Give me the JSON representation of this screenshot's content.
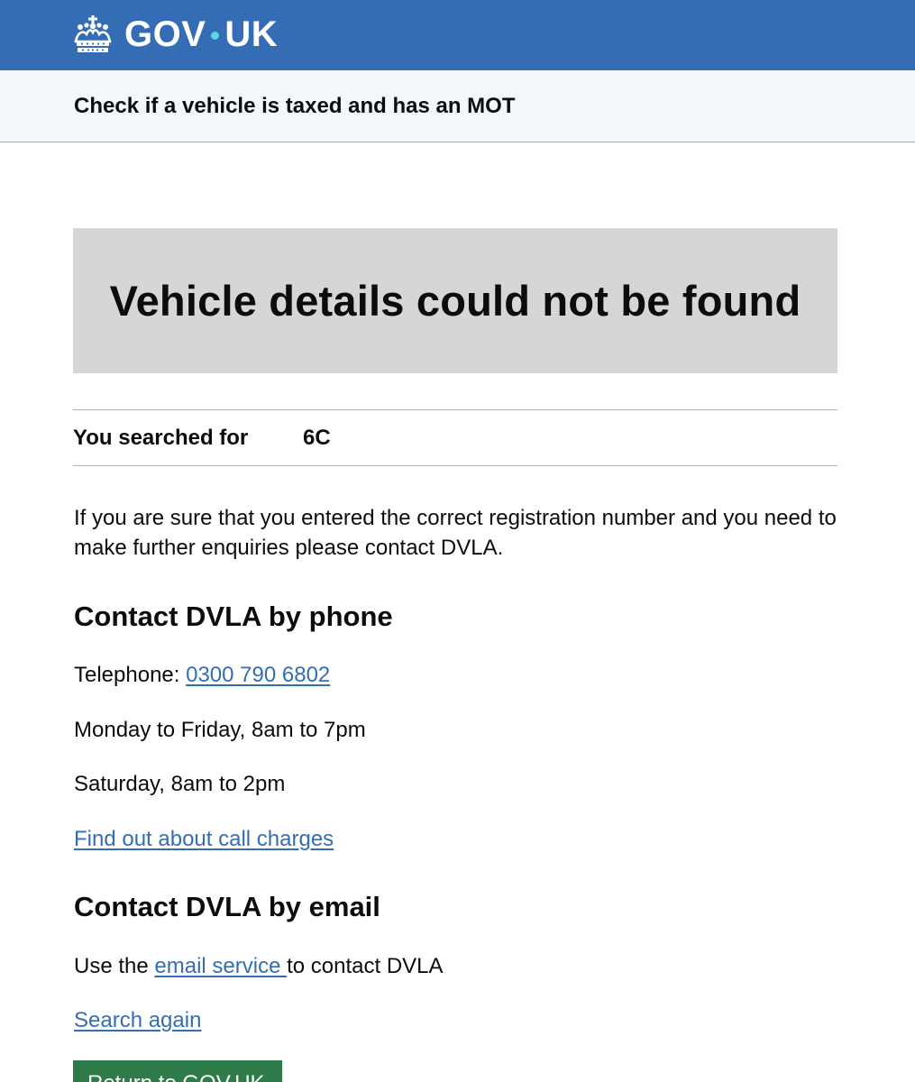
{
  "colors": {
    "brand": "#356db4",
    "dot": "#5bd7e6",
    "link": "#356db4",
    "panel": "#d6d6d6",
    "button": "#2e7a48"
  },
  "header": {
    "logo_left": "GOV",
    "logo_right": "UK",
    "crown_icon": "crown-icon"
  },
  "service": {
    "name": "Check if a vehicle is taxed and has an MOT"
  },
  "panel": {
    "title": "Vehicle details could not be found"
  },
  "summary": {
    "key": "You searched for",
    "value": "6C"
  },
  "intro": {
    "text": "If you are sure that you entered the correct registration number and you need to make further enquiries please contact DVLA."
  },
  "phone": {
    "heading": "Contact DVLA by phone",
    "telephone_label": "Telephone: ",
    "telephone_number": "0300 790 6802",
    "weekday_hours": "Monday to Friday, 8am to 7pm",
    "saturday_hours": "Saturday, 8am to 2pm",
    "call_charges_link": "Find out about call charges"
  },
  "email": {
    "heading": "Contact DVLA by email",
    "prefix": "Use the ",
    "link": "email service ",
    "suffix": "to contact DVLA"
  },
  "actions": {
    "search_again": "Search again",
    "return_button": "Return to GOV.UK"
  }
}
